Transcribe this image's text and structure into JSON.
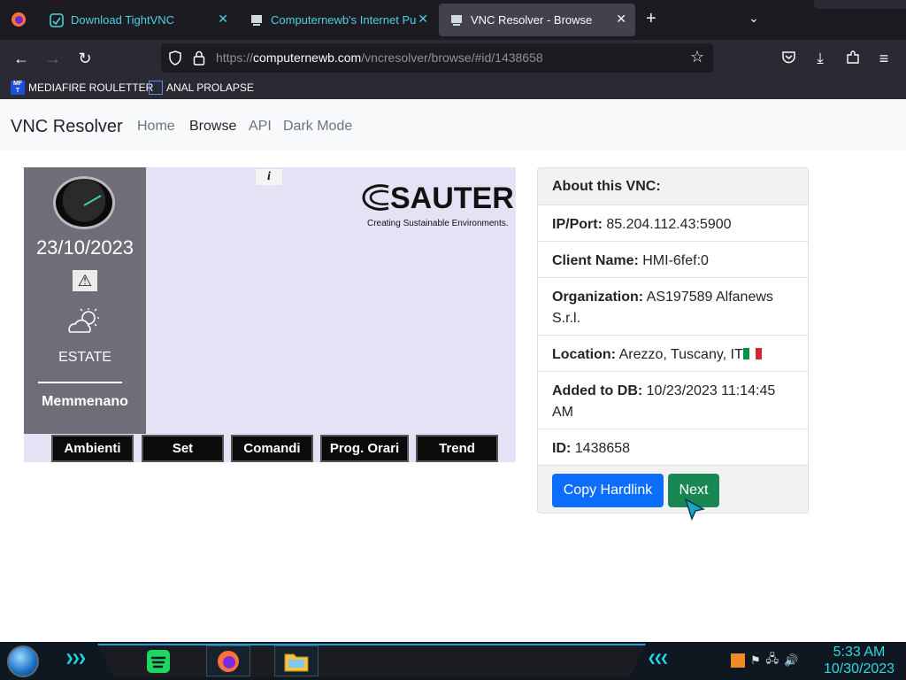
{
  "browser": {
    "tabs": [
      {
        "label": "Download TightVNC",
        "active": false
      },
      {
        "label": "Computernewb's Internet Pub",
        "active": false
      },
      {
        "label": "VNC Resolver - Browse",
        "active": true
      }
    ],
    "url_dim_prefix": "https://",
    "url_domain": "computernewb.com",
    "url_rest": "/vncresolver/browse/#id/1438658",
    "bookmarks": [
      {
        "label": "MEDIAFIRE ROULETTER",
        "icon": "mediafire-icon"
      },
      {
        "label": "ANAL PROLAPSE",
        "icon": "bookmark-icon"
      }
    ]
  },
  "site": {
    "brand": "VNC Resolver",
    "nav": [
      {
        "label": "Home",
        "active": false
      },
      {
        "label": "Browse",
        "active": true
      },
      {
        "label": "API",
        "active": false
      },
      {
        "label": "Dark Mode",
        "active": false
      }
    ]
  },
  "vnc_screen": {
    "clock_small_date": "",
    "date": "23/10/2023",
    "season": "ESTATE",
    "place": "Memmenano",
    "logo_word": "SAUTER",
    "logo_tagline": "Creating Sustainable Environments.",
    "info_icon": "i",
    "buttons": [
      "Ambienti",
      "Set",
      "Comandi",
      "Prog. Orari",
      "Trend"
    ]
  },
  "card": {
    "header": "About this VNC:",
    "rows": [
      {
        "label": "IP/Port:",
        "value": "85.204.112.43:5900"
      },
      {
        "label": "Client Name:",
        "value": "HMI-6fef:0"
      },
      {
        "label": "Organization:",
        "value": "AS197589 Alfanews S.r.l."
      },
      {
        "label": "Location:",
        "value": "Arezzo, Tuscany, IT"
      },
      {
        "label": "Added to DB:",
        "value": "10/23/2023 11:14:45 AM"
      },
      {
        "label": "ID:",
        "value": "1438658"
      }
    ],
    "copy_button": "Copy Hardlink",
    "next_button": "Next"
  },
  "taskbar": {
    "time": "5:33 AM",
    "date": "10/30/2023"
  },
  "colors": {
    "primary": "#0d6efd",
    "success": "#198754",
    "accent_cyan": "#4fd0e0"
  }
}
